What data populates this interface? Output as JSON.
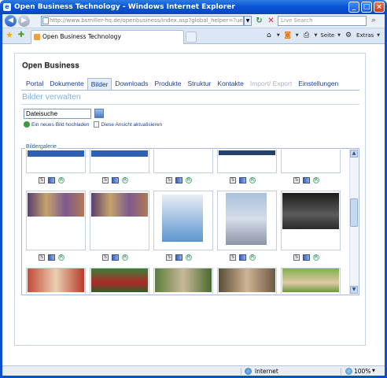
{
  "window": {
    "title": "Open Business Technology - Windows Internet Explorer"
  },
  "addressbar": {
    "url": "http://www.bsmiller-hq.de/openbusiness/index.asp?global_helper=?uesbhandlerreq",
    "search_placeholder": "Live Search"
  },
  "tab": {
    "label": "Open Business Technology"
  },
  "commandbar": {
    "page_label": "Seite",
    "tools_label": "Extras"
  },
  "site": {
    "title": "Open Business",
    "nav": [
      {
        "label": "Portal",
        "state": "normal"
      },
      {
        "label": "Dokumente",
        "state": "normal"
      },
      {
        "label": "Bilder",
        "state": "active"
      },
      {
        "label": "Downloads",
        "state": "normal"
      },
      {
        "label": "Produkte",
        "state": "normal"
      },
      {
        "label": "Struktur",
        "state": "normal"
      },
      {
        "label": "Kontakte",
        "state": "normal"
      },
      {
        "label": "Import/ Export",
        "state": "disabled"
      },
      {
        "label": "Einstellungen",
        "state": "normal"
      }
    ],
    "heading": "Bilder verwalten",
    "search_value": "Dateisuche",
    "actions": {
      "upload": "Ein neues Bild hochladen",
      "refresh": "Diese Ansicht aktualisieren"
    },
    "gallery_label": "Bildergalerie",
    "icon_labels": {
      "s": "S",
      "r": "R"
    }
  },
  "status": {
    "zone": "Internet",
    "zoom": "100%"
  },
  "colors": {
    "link": "#1c3f95",
    "heading": "#7fb0de",
    "titlebar": "#0a55d6"
  }
}
